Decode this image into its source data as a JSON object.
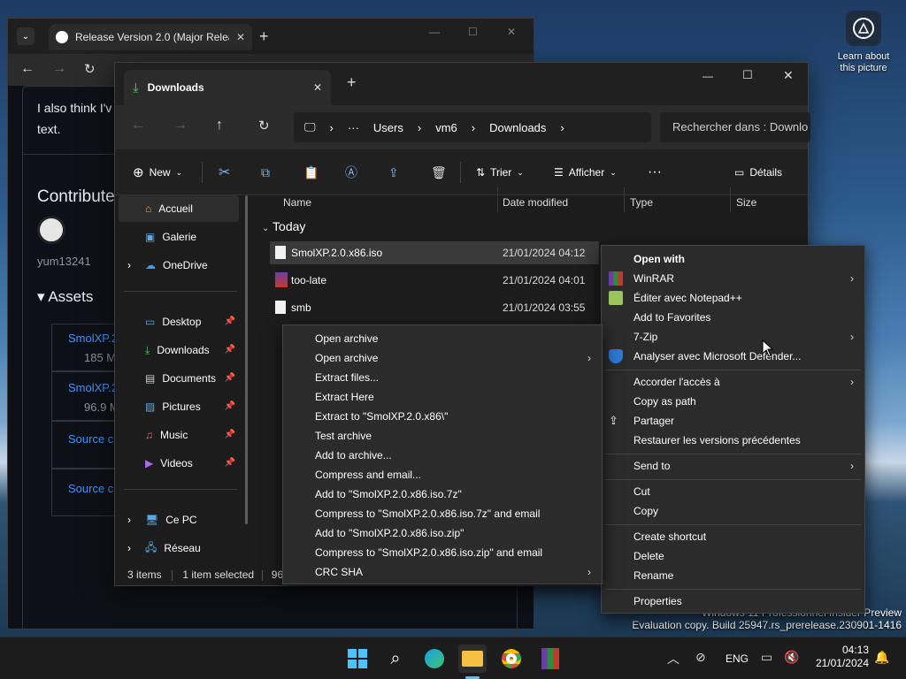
{
  "desktop": {
    "learn_picture": "Learn about this picture",
    "watermark_line1": "Windows 11 Professionnel Insider Preview",
    "watermark_line2": "Evaluation copy. Build 25947.rs_prerelease.230901-1416"
  },
  "browser": {
    "tab_title": "Release Version 2.0 (Major Relea",
    "text_snippet_1": "I also think I'v",
    "text_snippet_2": "text.",
    "contributors_heading": "Contribute",
    "contributor_name": "yum13241",
    "assets_heading": "Assets",
    "assets": [
      {
        "name": "SmolXP.2",
        "size": "185 MB"
      },
      {
        "name": "SmolXP.2",
        "size": "96.9 MB"
      },
      {
        "name": "Source c",
        "size": ""
      },
      {
        "name": "Source c",
        "size": ""
      }
    ]
  },
  "explorer": {
    "tab_title": "Downloads",
    "breadcrumb": [
      "Users",
      "vm6",
      "Downloads"
    ],
    "search_placeholder": "Rechercher dans : Downlo",
    "commands": {
      "new": "New",
      "sort": "Trier",
      "view": "Afficher",
      "details": "Détails"
    },
    "sidebar": [
      {
        "label": "Accueil",
        "icon": "home-icon",
        "selected": true
      },
      {
        "label": "Galerie",
        "icon": "gallery-icon"
      },
      {
        "label": "OneDrive",
        "icon": "cloud-icon"
      },
      {
        "label": "Desktop",
        "icon": "desktop-icon",
        "pinned": true
      },
      {
        "label": "Downloads",
        "icon": "download-icon",
        "pinned": true
      },
      {
        "label": "Documents",
        "icon": "document-icon",
        "pinned": true
      },
      {
        "label": "Pictures",
        "icon": "pictures-icon",
        "pinned": true
      },
      {
        "label": "Music",
        "icon": "music-icon",
        "pinned": true
      },
      {
        "label": "Videos",
        "icon": "videos-icon",
        "pinned": true
      },
      {
        "label": "Ce PC",
        "icon": "pc-icon"
      },
      {
        "label": "Réseau",
        "icon": "network-icon"
      }
    ],
    "columns": {
      "name": "Name",
      "date": "Date modified",
      "type": "Type",
      "size": "Size"
    },
    "group_label": "Today",
    "files": [
      {
        "name": "SmolXP.2.0.x86.iso",
        "date": "21/01/2024 04:12",
        "selected": true
      },
      {
        "name": "too-late",
        "date": "21/01/2024 04:01"
      },
      {
        "name": "smb",
        "date": "21/01/2024 03:55"
      }
    ],
    "status": {
      "count": "3 items",
      "selected": "1 item selected",
      "size": "96,9 M"
    }
  },
  "main_menu": {
    "items": [
      {
        "label": "Open with",
        "bold": true
      },
      {
        "label": "WinRAR",
        "submenu": true,
        "icon": "winrar-icon"
      },
      {
        "label": "Éditer avec Notepad++",
        "icon": "notepadpp-icon"
      },
      {
        "label": "Add to Favorites"
      },
      {
        "label": "7-Zip",
        "submenu": true,
        "hovered": true
      },
      {
        "label": "Analyser avec Microsoft Defender...",
        "icon": "defender-icon"
      },
      {
        "label": "Accorder l'accès à",
        "submenu": true
      },
      {
        "label": "Copy as path"
      },
      {
        "label": "Partager",
        "icon": "share-icon"
      },
      {
        "label": "Restaurer les versions précédentes"
      },
      {
        "label": "Send to",
        "submenu": true
      },
      {
        "label": "Cut"
      },
      {
        "label": "Copy"
      },
      {
        "label": "Create shortcut"
      },
      {
        "label": "Delete"
      },
      {
        "label": "Rename"
      },
      {
        "label": "Properties"
      }
    ]
  },
  "zip_menu": {
    "items": [
      {
        "label": "Open archive"
      },
      {
        "label": "Open archive",
        "submenu": true
      },
      {
        "label": "Extract files..."
      },
      {
        "label": "Extract Here"
      },
      {
        "label": "Extract to \"SmolXP.2.0.x86\\\""
      },
      {
        "label": "Test archive"
      },
      {
        "label": "Add to archive..."
      },
      {
        "label": "Compress and email..."
      },
      {
        "label": "Add to \"SmolXP.2.0.x86.iso.7z\""
      },
      {
        "label": "Compress to \"SmolXP.2.0.x86.iso.7z\" and email"
      },
      {
        "label": "Add to \"SmolXP.2.0.x86.iso.zip\""
      },
      {
        "label": "Compress to \"SmolXP.2.0.x86.iso.zip\" and email"
      },
      {
        "label": "CRC SHA",
        "submenu": true
      }
    ]
  },
  "taskbar": {
    "language": "ENG",
    "time": "04:13",
    "date": "21/01/2024",
    "apps": [
      "windows-start-icon",
      "search-icon",
      "edge-icon",
      "file-explorer-icon",
      "chrome-icon",
      "winrar-icon"
    ]
  }
}
